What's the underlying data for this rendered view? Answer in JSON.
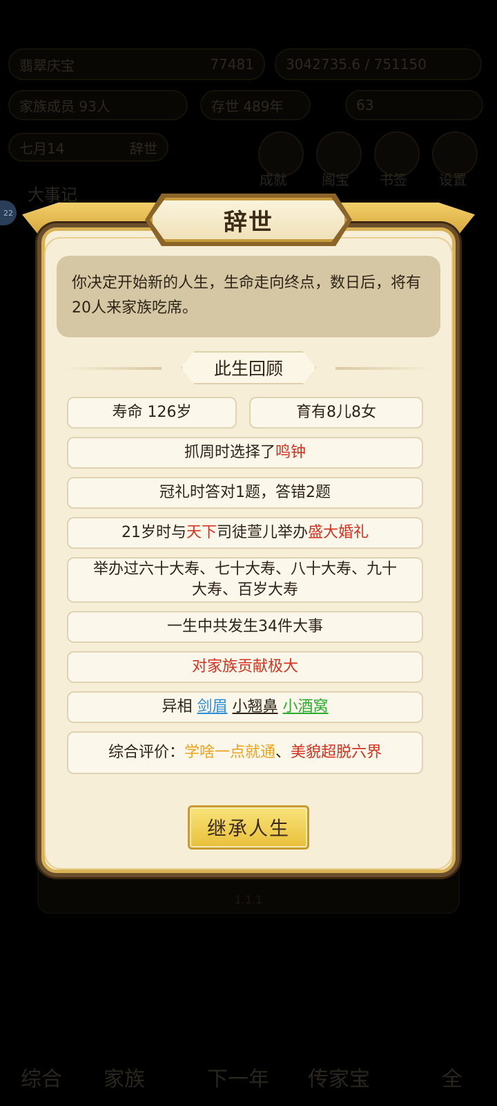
{
  "background": {
    "top_pills": [
      "翡翠庆宝",
      "77481",
      "3042735.6 / 751150",
      "家族成员 93人",
      "存世 489年",
      "63"
    ],
    "top_row3": [
      "七月14",
      "辞世"
    ],
    "icons": [
      "成就",
      "阁宝",
      "书签",
      "设置"
    ],
    "side_title": "大事记",
    "badge": "22",
    "version": "1.1.1",
    "bottom_nav": [
      "综合",
      "家族",
      "下一年",
      "传家宝",
      "全"
    ]
  },
  "dialog": {
    "title": "辞世",
    "message": "你决定开始新的人生，生命走向终点，数日后，将有20人来家族吃席。",
    "section_title": "此生回顾",
    "lifespan": "寿命 126岁",
    "children": "育有8儿8女",
    "zhuazhou_prefix": "抓周时选择了",
    "zhuazhou_item": "鸣钟",
    "guanli": "冠礼时答对1题，答错2题",
    "marriage_prefix": "21岁时与",
    "marriage_clan": "天下",
    "marriage_mid": "司徒萱儿举办",
    "marriage_event": "盛大婚礼",
    "birthdays": "举办过六十大寿、七十大寿、八十大寿、九十大寿、百岁大寿",
    "events": "一生中共发生34件大事",
    "contribution": "对家族贡献极大",
    "features_prefix": "异相",
    "feature_1": "剑眉",
    "feature_2": "小翘鼻",
    "feature_3": "小酒窝",
    "evaluation_prefix": "综合评价：",
    "evaluation_1": "学啥一点就通",
    "evaluation_sep": "、",
    "evaluation_2": "美貌超脱六界",
    "inherit_button": "继承人生"
  },
  "colors": {
    "highlight_red": "#d8311f",
    "feature_blue": "#2d8fd9",
    "feature_green": "#2cac2c",
    "evaluation_orange": "#f0a21a",
    "button_gold": "#f1cf55"
  }
}
